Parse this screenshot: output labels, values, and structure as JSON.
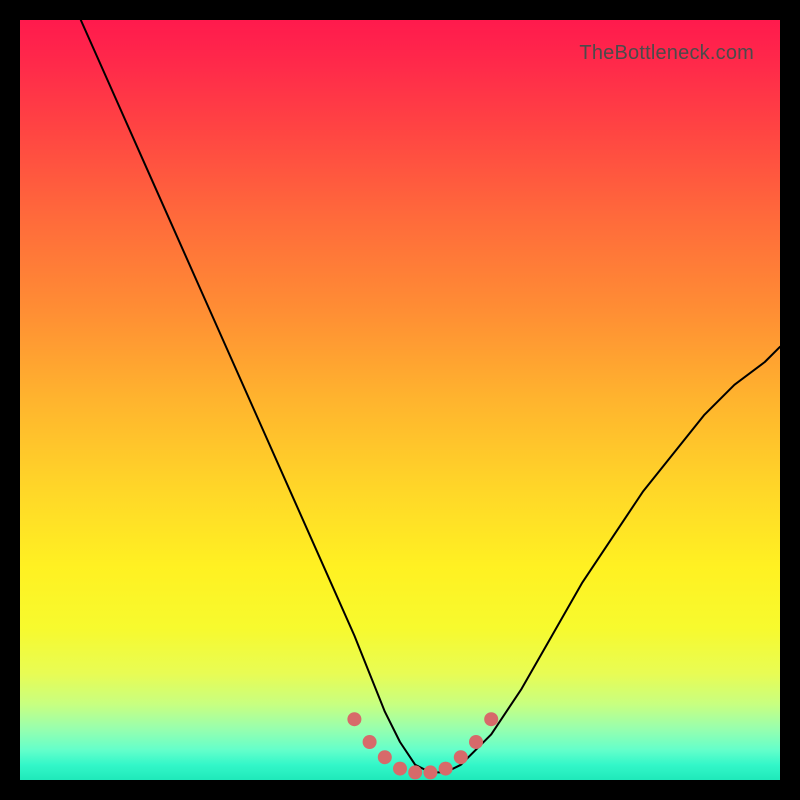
{
  "watermark": "TheBottleneck.com",
  "chart_data": {
    "type": "line",
    "title": "",
    "xlabel": "",
    "ylabel": "",
    "xlim": [
      0,
      100
    ],
    "ylim": [
      0,
      100
    ],
    "grid": false,
    "legend": false,
    "series": [
      {
        "name": "bottleneck-curve",
        "x": [
          8,
          12,
          16,
          20,
          24,
          28,
          32,
          36,
          40,
          44,
          46,
          48,
          50,
          52,
          54,
          56,
          58,
          62,
          66,
          70,
          74,
          78,
          82,
          86,
          90,
          94,
          98,
          100
        ],
        "y": [
          100,
          91,
          82,
          73,
          64,
          55,
          46,
          37,
          28,
          19,
          14,
          9,
          5,
          2,
          1,
          1,
          2,
          6,
          12,
          19,
          26,
          32,
          38,
          43,
          48,
          52,
          55,
          57
        ]
      }
    ],
    "markers": {
      "name": "highlight-dots",
      "color": "#d76a6a",
      "points": [
        {
          "x": 44,
          "y": 8
        },
        {
          "x": 46,
          "y": 5
        },
        {
          "x": 48,
          "y": 3
        },
        {
          "x": 50,
          "y": 1.5
        },
        {
          "x": 52,
          "y": 1
        },
        {
          "x": 54,
          "y": 1
        },
        {
          "x": 56,
          "y": 1.5
        },
        {
          "x": 58,
          "y": 3
        },
        {
          "x": 60,
          "y": 5
        },
        {
          "x": 62,
          "y": 8
        }
      ]
    },
    "background_gradient": {
      "top": "#ff1a4d",
      "mid": "#fff122",
      "bottom": "#1fe9ba"
    }
  }
}
